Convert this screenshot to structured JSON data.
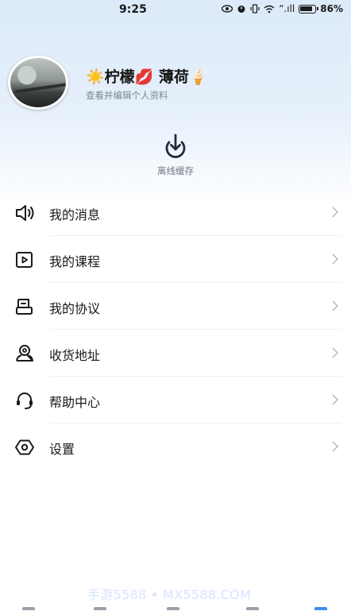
{
  "status_bar": {
    "time": "9:25",
    "signal_text": "“.ıll",
    "battery_percent": "86%"
  },
  "profile": {
    "name": "☀️柠檬💋 薄荷🍦",
    "subtitle": "查看并编辑个人资料"
  },
  "offline_cache": {
    "label": "离线缓存",
    "icon": "download-circle-icon"
  },
  "menu": {
    "items": [
      {
        "label": "我的消息",
        "icon": "speaker-icon"
      },
      {
        "label": "我的课程",
        "icon": "play-square-icon"
      },
      {
        "label": "我的协议",
        "icon": "document-icon"
      },
      {
        "label": "收货地址",
        "icon": "location-person-icon"
      },
      {
        "label": "帮助中心",
        "icon": "headset-icon"
      },
      {
        "label": "设置",
        "icon": "settings-eye-icon"
      }
    ]
  },
  "watermark": "手游5588 • MX5588.COM",
  "colors": {
    "header_gradient_top": "#dceaf9",
    "text_primary": "#1a1a1a",
    "text_secondary": "#7d8792",
    "chevron": "#b3b8be"
  }
}
